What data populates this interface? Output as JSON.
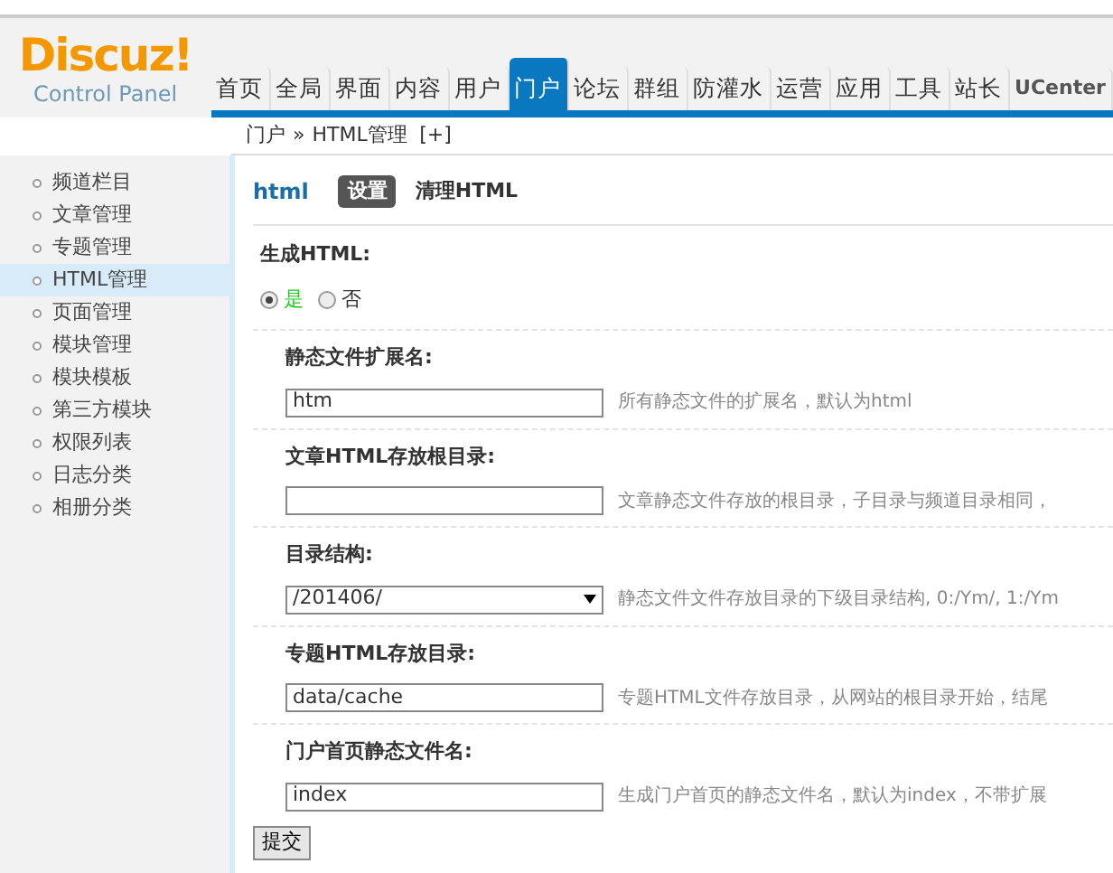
{
  "logo": {
    "title": "Discuz!",
    "subtitle": "Control Panel"
  },
  "nav_tabs": [
    {
      "label": "首页",
      "selected": false
    },
    {
      "label": "全局",
      "selected": false
    },
    {
      "label": "界面",
      "selected": false
    },
    {
      "label": "内容",
      "selected": false
    },
    {
      "label": "用户",
      "selected": false
    },
    {
      "label": "门户",
      "selected": true
    },
    {
      "label": "论坛",
      "selected": false
    },
    {
      "label": "群组",
      "selected": false
    },
    {
      "label": "防灌水",
      "selected": false
    },
    {
      "label": "运营",
      "selected": false
    },
    {
      "label": "应用",
      "selected": false
    },
    {
      "label": "工具",
      "selected": false
    },
    {
      "label": "站长",
      "selected": false
    },
    {
      "label": "UCenter",
      "selected": false
    }
  ],
  "breadcrumb": {
    "parent": "门户",
    "separator": "»",
    "current": "HTML管理",
    "add": "[+]"
  },
  "sidebar": {
    "items": [
      {
        "label": "频道栏目",
        "selected": false
      },
      {
        "label": "文章管理",
        "selected": false
      },
      {
        "label": "专题管理",
        "selected": false
      },
      {
        "label": "HTML管理",
        "selected": true
      },
      {
        "label": "页面管理",
        "selected": false
      },
      {
        "label": "模块管理",
        "selected": false
      },
      {
        "label": "模块模板",
        "selected": false
      },
      {
        "label": "第三方模块",
        "selected": false
      },
      {
        "label": "权限列表",
        "selected": false
      },
      {
        "label": "日志分类",
        "selected": false
      },
      {
        "label": "相册分类",
        "selected": false
      }
    ]
  },
  "section": {
    "title": "html",
    "tabs": [
      {
        "label": "设置",
        "selected": true
      },
      {
        "label": "清理HTML",
        "selected": false
      }
    ]
  },
  "generate": {
    "label": "生成HTML:",
    "options": [
      {
        "label": "是",
        "selected": true
      },
      {
        "label": "否",
        "selected": false
      }
    ]
  },
  "fields": [
    {
      "kind": "text",
      "label": "静态文件扩展名:",
      "value": "htm",
      "hint": "所有静态文件的扩展名，默认为html"
    },
    {
      "kind": "text",
      "label": "文章HTML存放根目录:",
      "hint": "文章静态文件存放的根目录，子目录与频道目录相同，"
    },
    {
      "kind": "select",
      "label": "目录结构:",
      "value": "/201406/",
      "hint": "静态文件文件存放目录的下级目录结构, 0:/Ym/, 1:/Ym"
    },
    {
      "kind": "text",
      "label": "专题HTML存放目录:",
      "value": "data/cache",
      "hint": "专题HTML文件存放目录，从网站的根目录开始，结尾"
    },
    {
      "kind": "text",
      "label": "门户首页静态文件名:",
      "value": "index",
      "hint": "生成门户首页的静态文件名，默认为index，不带扩展"
    }
  ],
  "submit": "提交"
}
